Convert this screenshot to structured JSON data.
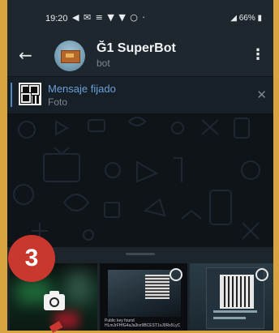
{
  "status_bar": {
    "time": "19:20",
    "icons_text": "◀ ✉ ≡ ▼ ▼ ○  ·",
    "right": "◢ 66% ▮"
  },
  "header": {
    "title": "Ğ1 SuperBot",
    "subtitle": "bot"
  },
  "pinned": {
    "title": "Mensaje fijado",
    "subtitle": "Foto"
  },
  "attach_sheet": {
    "thumb2_text_1": "Public key found",
    "thumb2_text_2": "HLmJrFHfG4aJa3ixr9BCEST1vJ9Rx5LyC"
  },
  "badge": {
    "number": "3"
  },
  "colors": {
    "accent": "#5288c1",
    "badge": "#c8382e",
    "header_bg": "#1e262e"
  }
}
